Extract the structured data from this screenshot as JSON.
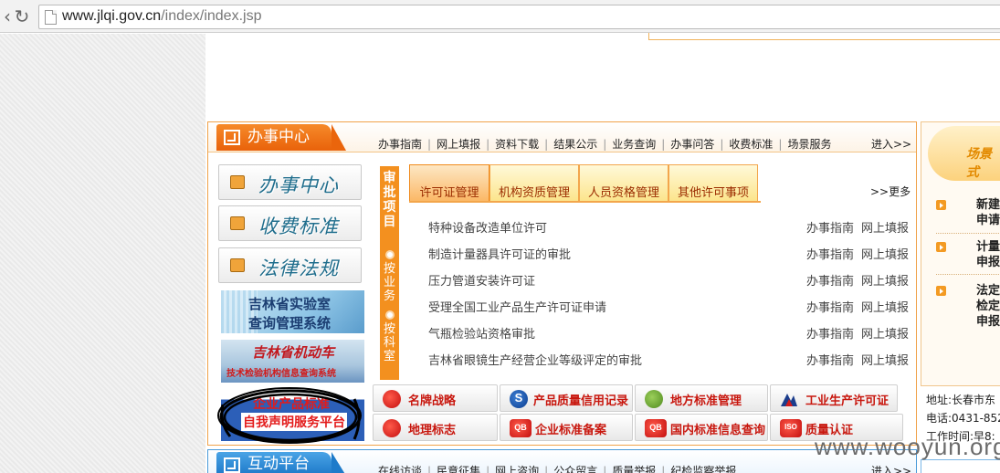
{
  "browser": {
    "url_host": "www.jlqi.gov.cn",
    "url_path": "/index/index.jsp"
  },
  "office": {
    "title": "办事中心",
    "nav": [
      "办事指南",
      "网上填报",
      "资料下载",
      "结果公示",
      "业务查询",
      "办事问答",
      "收费标准",
      "场景服务"
    ],
    "enter": "进入>>"
  },
  "side_buttons": [
    "办事中心",
    "收费标准",
    "法律法规"
  ],
  "banners": {
    "lab_line1": "吉林省实验室",
    "lab_line2": "查询管理系统",
    "car_line1": "吉林省机动车",
    "car_line2": "技术检验机构信息查询系统",
    "std_line1": "企业产品标准",
    "std_line2": "自我声明服务平台"
  },
  "approval": {
    "vertical_title": "审批项目",
    "option1": "按业务",
    "option2": "按科室",
    "tabs": [
      "许可证管理",
      "机构资质管理",
      "人员资格管理",
      "其他许可事项"
    ],
    "more": ">>更多",
    "items": [
      "特种设备改造单位许可",
      "制造计量器具许可证的审批",
      "压力管道安装许可证",
      "受理全国工业产品生产许可证申请",
      "气瓶检验站资格审批",
      "吉林省眼镜生产经营企业等级评定的审批"
    ],
    "guide_label": "办事指南",
    "report_label": "网上填报"
  },
  "services": [
    {
      "label": "名牌战略",
      "icon": "brand-strategy-icon",
      "color": "red",
      "glyph": ""
    },
    {
      "label": "产品质量信用记录",
      "icon": "quality-credit-icon",
      "color": "blue",
      "glyph": "S"
    },
    {
      "label": "地方标准管理",
      "icon": "local-standard-icon",
      "color": "green",
      "glyph": ""
    },
    {
      "label": "工业生产许可证",
      "icon": "industrial-license-icon",
      "color": "navy",
      "glyph": ""
    },
    {
      "label": "地理标志",
      "icon": "geo-mark-icon",
      "color": "red",
      "glyph": ""
    },
    {
      "label": "企业标准备案",
      "icon": "enterprise-standard-icon",
      "color": "red",
      "glyph": "QB"
    },
    {
      "label": "国内标准信息查询",
      "icon": "domestic-standard-icon",
      "color": "red",
      "glyph": "QB"
    },
    {
      "label": "质量认证",
      "icon": "quality-cert-icon",
      "color": "red",
      "glyph": "ISO"
    }
  ],
  "right_col": {
    "banner_text": "场景式",
    "news": [
      "新建申请",
      "计量申报",
      "法定检定申报"
    ]
  },
  "contact": {
    "address": "地址:长春市东",
    "phone": "电话:0431-852",
    "hours": "工作时间:早8:"
  },
  "interaction": {
    "title": "互动平台",
    "nav": [
      "在线访谈",
      "民意征集",
      "网上咨询",
      "公众留言",
      "质量举报",
      "纪检监察举报"
    ],
    "enter": "进入>>"
  },
  "watermark": "www.wooyun.org"
}
